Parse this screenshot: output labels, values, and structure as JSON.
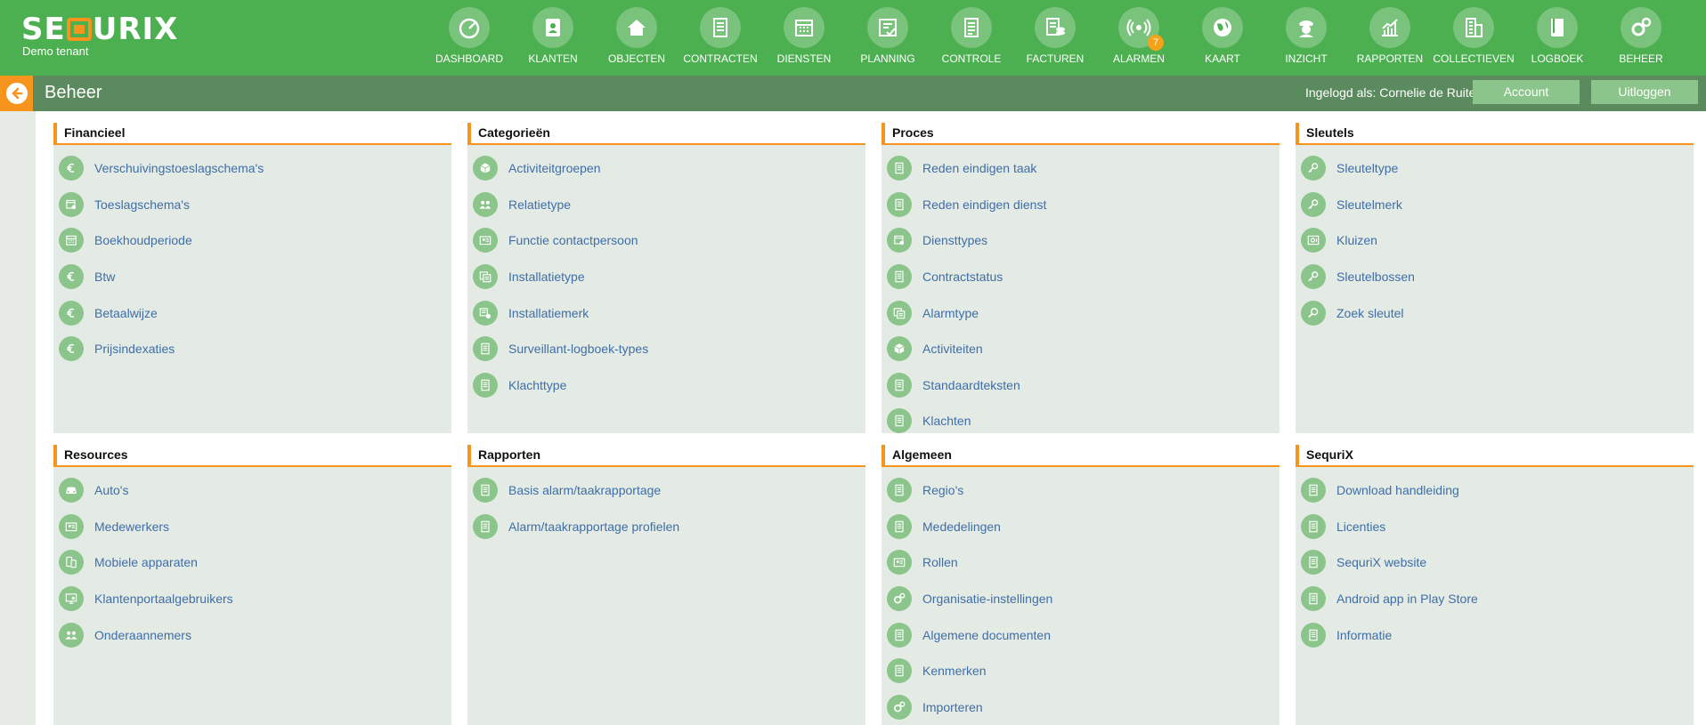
{
  "brand": {
    "logo_pre": "SE",
    "logo_post": "URIX",
    "tenant": "Demo tenant"
  },
  "nav": [
    {
      "label": "DASHBOARD",
      "icon": "dashboard-icon"
    },
    {
      "label": "KLANTEN",
      "icon": "contacts-icon"
    },
    {
      "label": "OBJECTEN",
      "icon": "home-icon"
    },
    {
      "label": "CONTRACTEN",
      "icon": "document-icon"
    },
    {
      "label": "DIENSTEN",
      "icon": "calendar-icon"
    },
    {
      "label": "PLANNING",
      "icon": "planning-icon"
    },
    {
      "label": "CONTROLE",
      "icon": "checklist-icon"
    },
    {
      "label": "FACTUREN",
      "icon": "invoice-icon"
    },
    {
      "label": "ALARMEN",
      "icon": "alarm-broadcast-icon",
      "badge": "7"
    },
    {
      "label": "KAART",
      "icon": "globe-icon"
    },
    {
      "label": "INZICHT",
      "icon": "officer-icon"
    },
    {
      "label": "RAPPORTEN",
      "icon": "chart-icon"
    },
    {
      "label": "COLLECTIEVEN",
      "icon": "building-icon"
    },
    {
      "label": "LOGBOEK",
      "icon": "book-icon"
    },
    {
      "label": "BEHEER",
      "icon": "gears-icon"
    }
  ],
  "header": {
    "title": "Beheer",
    "logged_in": "Ingelogd als: Cornelie de Ruiter",
    "account": "Account",
    "logout": "Uitloggen"
  },
  "panels": [
    {
      "title": "Financieel",
      "items": [
        {
          "label": "Verschuivingstoeslagschema's",
          "icon": "euro-icon"
        },
        {
          "label": "Toeslagschema's",
          "icon": "schedule-icon"
        },
        {
          "label": "Boekhoudperiode",
          "icon": "calendar-icon"
        },
        {
          "label": "Btw",
          "icon": "euro-icon"
        },
        {
          "label": "Betaalwijze",
          "icon": "euro-icon"
        },
        {
          "label": "Prijsindexaties",
          "icon": "euro-icon"
        }
      ]
    },
    {
      "title": "Categorieën",
      "items": [
        {
          "label": "Activiteitgroepen",
          "icon": "cube-icon"
        },
        {
          "label": "Relatietype",
          "icon": "people-icon"
        },
        {
          "label": "Functie contactpersoon",
          "icon": "id-card-icon"
        },
        {
          "label": "Installatietype",
          "icon": "install-icon"
        },
        {
          "label": "Installatiemerk",
          "icon": "install-brand-icon"
        },
        {
          "label": "Surveillant-logboek-types",
          "icon": "document-icon"
        },
        {
          "label": "Klachttype",
          "icon": "document-icon"
        }
      ]
    },
    {
      "title": "Proces",
      "items": [
        {
          "label": "Reden eindigen taak",
          "icon": "document-icon"
        },
        {
          "label": "Reden eindigen dienst",
          "icon": "document-icon"
        },
        {
          "label": "Diensttypes",
          "icon": "schedule-icon"
        },
        {
          "label": "Contractstatus",
          "icon": "document-icon"
        },
        {
          "label": "Alarmtype",
          "icon": "install-icon"
        },
        {
          "label": "Activiteiten",
          "icon": "cube-icon"
        },
        {
          "label": "Standaardteksten",
          "icon": "document-icon"
        },
        {
          "label": "Klachten",
          "icon": "document-icon"
        }
      ]
    },
    {
      "title": "Sleutels",
      "items": [
        {
          "label": "Sleuteltype",
          "icon": "key-icon"
        },
        {
          "label": "Sleutelmerk",
          "icon": "key-icon"
        },
        {
          "label": "Kluizen",
          "icon": "safe-icon"
        },
        {
          "label": "Sleutelbossen",
          "icon": "key-icon"
        },
        {
          "label": "Zoek sleutel",
          "icon": "key-search-icon"
        }
      ]
    },
    {
      "title": "Resources",
      "items": [
        {
          "label": "Auto's",
          "icon": "car-icon"
        },
        {
          "label": "Medewerkers",
          "icon": "id-card-icon"
        },
        {
          "label": "Mobiele apparaten",
          "icon": "mobile-icon"
        },
        {
          "label": "Klantenportaalgebruikers",
          "icon": "monitor-user-icon"
        },
        {
          "label": "Onderaannemers",
          "icon": "people-icon"
        }
      ]
    },
    {
      "title": "Rapporten",
      "items": [
        {
          "label": "Basis alarm/taakrapportage",
          "icon": "document-icon"
        },
        {
          "label": "Alarm/taakrapportage profielen",
          "icon": "document-icon"
        }
      ]
    },
    {
      "title": "Algemeen",
      "items": [
        {
          "label": "Regio's",
          "icon": "document-icon"
        },
        {
          "label": "Mededelingen",
          "icon": "document-icon"
        },
        {
          "label": "Rollen",
          "icon": "id-card-icon"
        },
        {
          "label": "Organisatie-instellingen",
          "icon": "gears-icon"
        },
        {
          "label": "Algemene documenten",
          "icon": "document-icon"
        },
        {
          "label": "Kenmerken",
          "icon": "document-icon"
        },
        {
          "label": "Importeren",
          "icon": "gears-icon"
        }
      ]
    },
    {
      "title": "SequriX",
      "items": [
        {
          "label": "Download handleiding",
          "icon": "document-icon"
        },
        {
          "label": "Licenties",
          "icon": "document-icon"
        },
        {
          "label": "SequriX website",
          "icon": "document-icon"
        },
        {
          "label": "Android app in Play Store",
          "icon": "document-icon"
        },
        {
          "label": "Informatie",
          "icon": "document-icon"
        }
      ]
    }
  ]
}
